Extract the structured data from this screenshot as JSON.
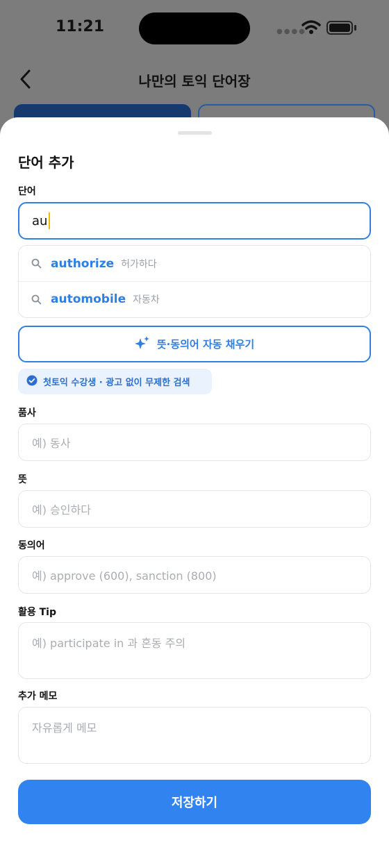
{
  "status_bar": {
    "time": "11:21"
  },
  "header": {
    "title": "나만의 토익 단어장"
  },
  "sheet": {
    "title": "단어 추가",
    "word": {
      "label": "단어",
      "value": "au"
    },
    "suggestions": [
      {
        "word": "authorize",
        "meaning": "허가하다"
      },
      {
        "word": "automobile",
        "meaning": "자동차"
      }
    ],
    "autofill_button": "뜻·동의어 자동 채우기",
    "badge": "첫토익 수강생 · 광고 없이 무제한 검색",
    "fields": [
      {
        "label": "품사",
        "placeholder": "예) 동사"
      },
      {
        "label": "뜻",
        "placeholder": "예) 승인하다"
      },
      {
        "label": "동의어",
        "placeholder": "예) approve (600), sanction (800)"
      },
      {
        "label": "활용 Tip",
        "placeholder": "예) participate in 과 혼동 주의"
      },
      {
        "label": "추가 메모",
        "placeholder": "자유롭게 메모"
      }
    ],
    "save_button": "저장하기"
  },
  "colors": {
    "accent": "#3183f0",
    "accent_dark": "#2f7fe0",
    "badge_bg": "#eaf2fd",
    "caret": "#f5b800",
    "dim_background": "#7c7c7c"
  }
}
